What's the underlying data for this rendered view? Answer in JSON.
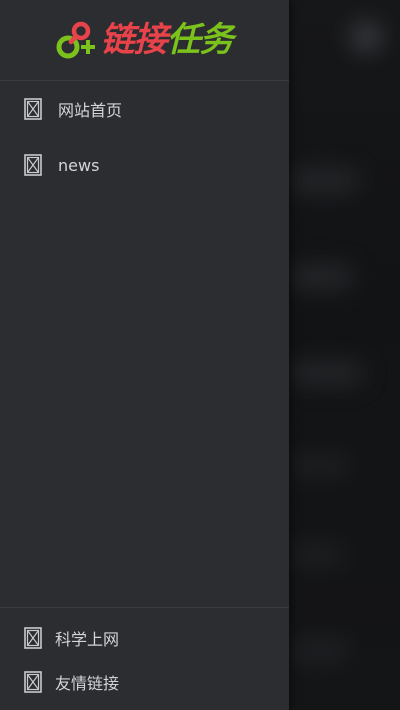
{
  "app": {
    "logo_text": [
      "链",
      "接",
      "任",
      "务"
    ],
    "logo_colors": {
      "red": "#e8434a",
      "green": "#7cc21c"
    }
  },
  "drawer": {
    "background": "#2c2d30",
    "top_menu": [
      {
        "label": "网站首页",
        "icon": "broken-image-icon"
      },
      {
        "label": "news",
        "icon": "broken-image-icon"
      }
    ],
    "bottom_menu": [
      {
        "label": "科学上网",
        "icon": "broken-image-icon"
      },
      {
        "label": "友情链接",
        "icon": "broken-image-icon"
      }
    ]
  }
}
